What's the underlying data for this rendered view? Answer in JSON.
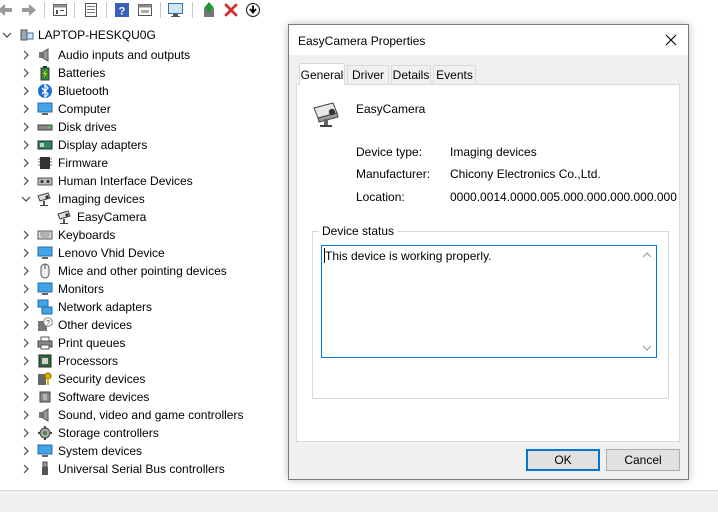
{
  "toolbar": {
    "icons": [
      "back-icon",
      "forward-icon",
      "properties-icon",
      "view-icon",
      "help-icon",
      "update-driver-icon",
      "monitor-icon",
      "enable-device-icon",
      "uninstall-icon",
      "download-icon"
    ]
  },
  "tree": {
    "root": "LAPTOP-HESKQU0G",
    "items": [
      {
        "label": "Audio inputs and outputs",
        "icon": "speaker-icon"
      },
      {
        "label": "Batteries",
        "icon": "battery-icon"
      },
      {
        "label": "Bluetooth",
        "icon": "bluetooth-icon"
      },
      {
        "label": "Computer",
        "icon": "computer-icon"
      },
      {
        "label": "Disk drives",
        "icon": "disk-icon"
      },
      {
        "label": "Display adapters",
        "icon": "display-adapter-icon"
      },
      {
        "label": "Firmware",
        "icon": "firmware-icon"
      },
      {
        "label": "Human Interface Devices",
        "icon": "hid-icon"
      },
      {
        "label": "Imaging devices",
        "icon": "camera-icon",
        "expanded": true
      },
      {
        "label": "EasyCamera",
        "icon": "camera-icon",
        "child": true
      },
      {
        "label": "Keyboards",
        "icon": "keyboard-icon"
      },
      {
        "label": "Lenovo Vhid Device",
        "icon": "monitor-icon"
      },
      {
        "label": "Mice and other pointing devices",
        "icon": "mouse-icon"
      },
      {
        "label": "Monitors",
        "icon": "monitor-icon"
      },
      {
        "label": "Network adapters",
        "icon": "network-icon"
      },
      {
        "label": "Other devices",
        "icon": "unknown-device-icon"
      },
      {
        "label": "Print queues",
        "icon": "printer-icon"
      },
      {
        "label": "Processors",
        "icon": "processor-icon"
      },
      {
        "label": "Security devices",
        "icon": "security-icon"
      },
      {
        "label": "Software devices",
        "icon": "software-device-icon"
      },
      {
        "label": "Sound, video and game controllers",
        "icon": "speaker-icon"
      },
      {
        "label": "Storage controllers",
        "icon": "storage-icon"
      },
      {
        "label": "System devices",
        "icon": "system-icon"
      },
      {
        "label": "Universal Serial Bus controllers",
        "icon": "usb-icon"
      }
    ]
  },
  "dialog": {
    "title": "EasyCamera Properties",
    "tabs": [
      "General",
      "Driver",
      "Details",
      "Events"
    ],
    "active_tab": "General",
    "device_name": "EasyCamera",
    "device_type_label": "Device type:",
    "device_type_value": "Imaging devices",
    "manufacturer_label": "Manufacturer:",
    "manufacturer_value": "Chicony Electronics Co.,Ltd.",
    "location_label": "Location:",
    "location_value": "0000.0014.0000.005.000.000.000.000.000",
    "status_group_label": "Device status",
    "status_text": "This device is working properly.",
    "ok_label": "OK",
    "cancel_label": "Cancel"
  },
  "colors": {
    "accent": "#0078d7",
    "dialog_bg": "#f0f0f0",
    "close_red": "#d32f2f"
  }
}
